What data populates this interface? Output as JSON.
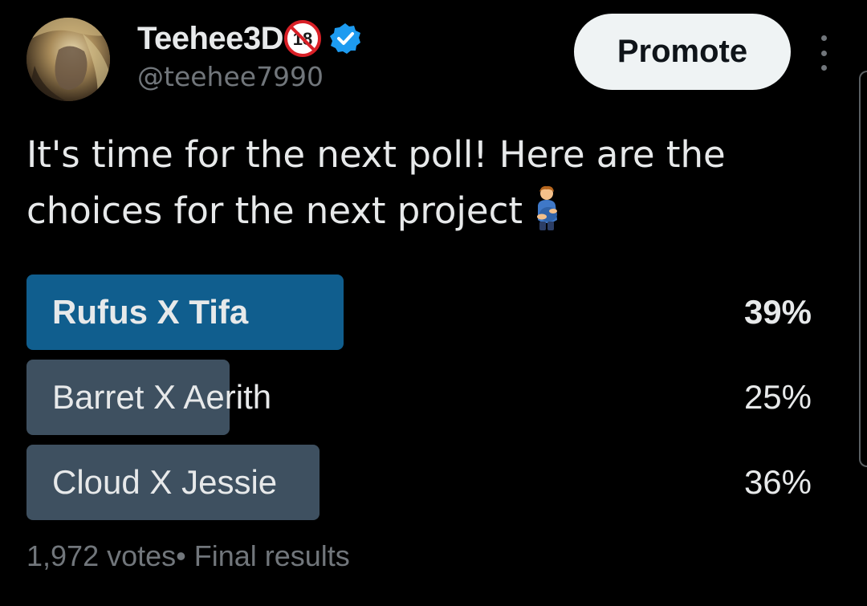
{
  "author": {
    "display_name": "Teehee3D",
    "handle": "@teehee7990",
    "avatar_icon": "profile-avatar",
    "badges": [
      "no-under-18-icon",
      "verified-icon"
    ],
    "verified_color": "#1d9bf0"
  },
  "header": {
    "promote_label": "Promote",
    "more_icon": "more-vertical-icon"
  },
  "tweet": {
    "text": "It's time for the next poll! Here are the choices for the next project",
    "emoji_icon": "pregnant-man-emoji"
  },
  "poll": {
    "options": [
      {
        "label": "Rufus X Tifa",
        "percent_text": "39%",
        "percent": 39,
        "winner": true
      },
      {
        "label": "Barret X Aerith",
        "percent_text": "25%",
        "percent": 25,
        "winner": false
      },
      {
        "label": "Cloud X Jessie",
        "percent_text": "36%",
        "percent": 36,
        "winner": false
      }
    ],
    "footer": "1,972 votes• Final results",
    "winner_color": "#105e8e",
    "other_color": "#3e5060"
  }
}
